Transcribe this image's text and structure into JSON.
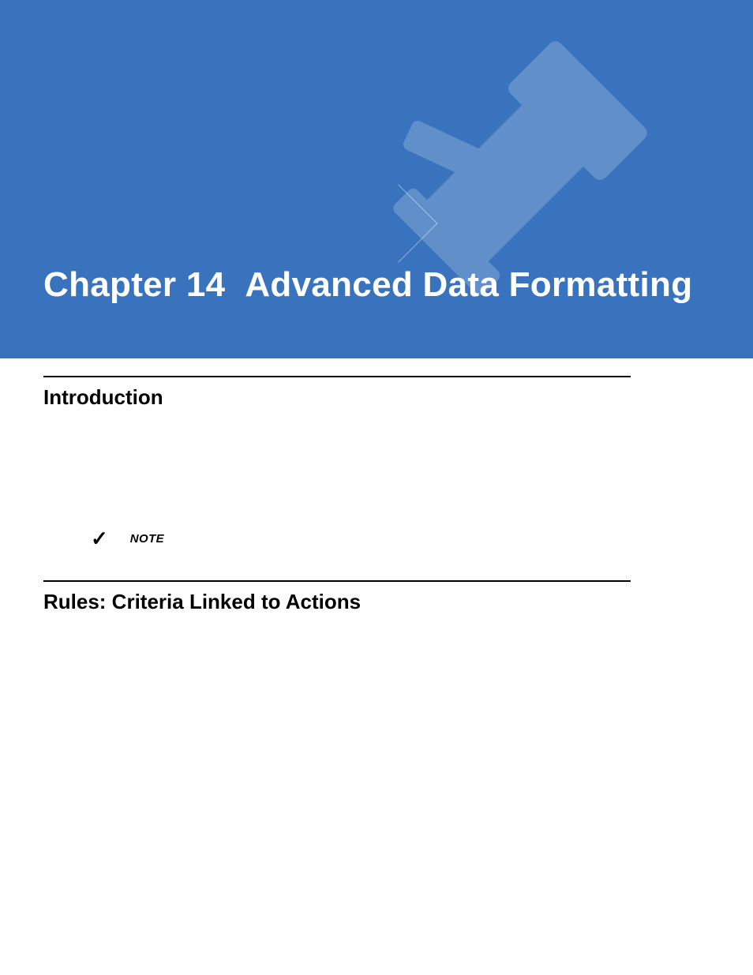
{
  "banner": {
    "chapter_label": "Chapter 14",
    "chapter_title": "Advanced Data Formatting"
  },
  "sections": {
    "intro_heading": "Introduction",
    "rules_heading": "Rules: Criteria Linked to Actions"
  },
  "note": {
    "icon": "✓",
    "label": "NOTE"
  }
}
